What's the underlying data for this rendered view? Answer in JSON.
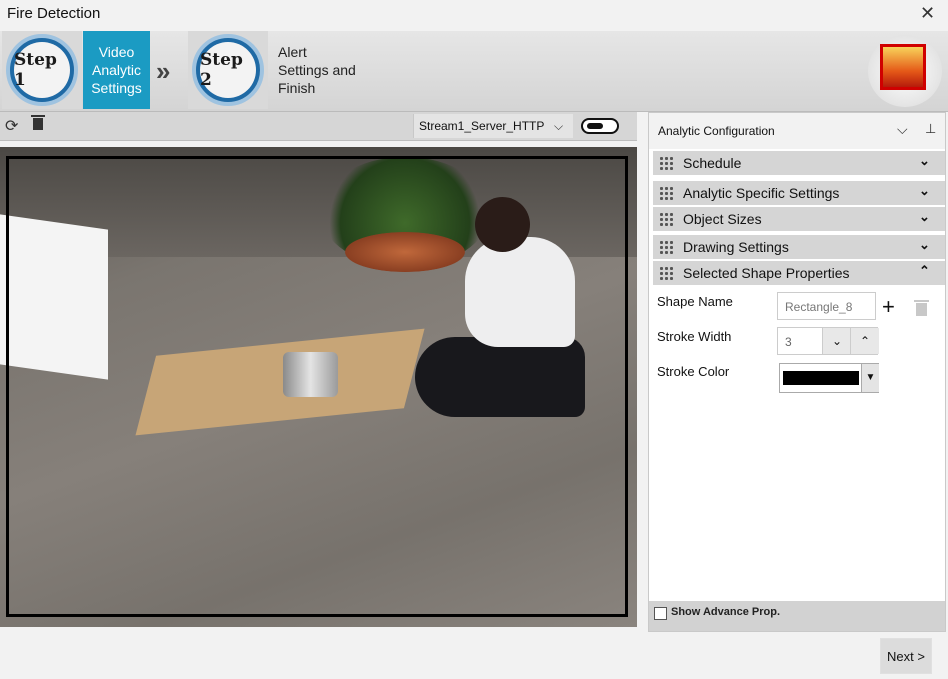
{
  "window": {
    "title": "Fire Detection",
    "close_symbol": "✕"
  },
  "steps": [
    {
      "badge": "Step 1",
      "label": "Video Analytic Settings",
      "active": true
    },
    {
      "badge": "Step 2",
      "label": "Alert Settings and Finish",
      "active": false
    }
  ],
  "steps_separator": "»",
  "video_toolbar": {
    "refresh_icon": "refresh-icon",
    "delete_icon": "trash-icon",
    "stream_select": "Stream1_Server_HTTP",
    "stream_chevron": "⌵"
  },
  "panel": {
    "title": "Analytic Configuration",
    "chevron": "⌵",
    "pin": "⊥",
    "sections": [
      {
        "label": "Schedule",
        "chevron": "⌄"
      },
      {
        "label": "Analytic Specific Settings",
        "chevron": "⌄"
      },
      {
        "label": "Object Sizes",
        "chevron": "⌄"
      },
      {
        "label": "Drawing Settings",
        "chevron": "⌄"
      },
      {
        "label": "Selected Shape Properties",
        "chevron": "⌃"
      }
    ],
    "properties": {
      "shape_name_label": "Shape Name",
      "shape_name_value": "Rectangle_8",
      "add_symbol": "+",
      "stroke_width_label": "Stroke Width",
      "stroke_width_value": "3",
      "down_symbol": "⌄",
      "up_symbol": "⌃",
      "stroke_color_label": "Stroke Color",
      "stroke_color_value": "#000000",
      "dropdown_symbol": "▼"
    },
    "footer": {
      "advance_label": "Show Advance Prop."
    }
  },
  "next_button": "Next >",
  "colors": {
    "accent": "#1b9bc3",
    "step_ring": "#1f6aa5",
    "section_bg": "#d5d5d5"
  }
}
